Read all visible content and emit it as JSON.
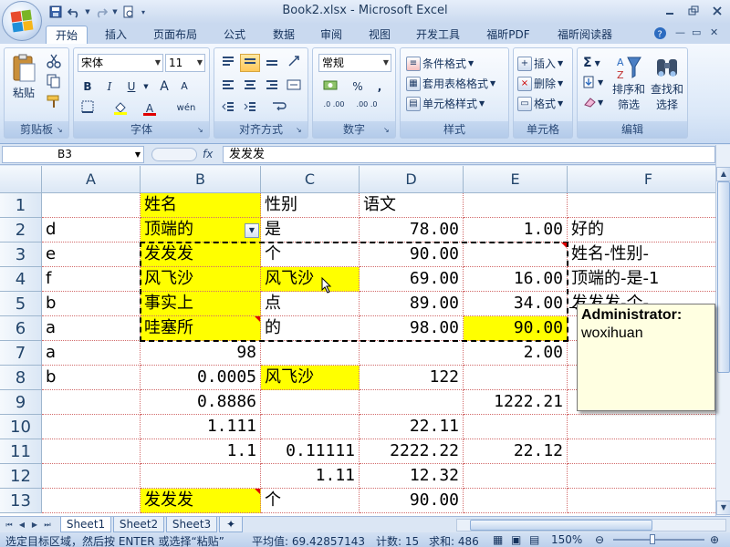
{
  "window": {
    "title": "Book2.xlsx - Microsoft Excel",
    "controls": [
      "minimize-icon",
      "restore-icon",
      "close-icon"
    ]
  },
  "quick_access": [
    "save-icon",
    "undo-icon",
    "redo-icon",
    "print-preview-icon"
  ],
  "tabs": [
    {
      "label": "开始",
      "active": true
    },
    {
      "label": "插入"
    },
    {
      "label": "页面布局"
    },
    {
      "label": "公式"
    },
    {
      "label": "数据"
    },
    {
      "label": "审阅"
    },
    {
      "label": "视图"
    },
    {
      "label": "开发工具"
    },
    {
      "label": "福昕PDF"
    },
    {
      "label": "福昕阅读器"
    }
  ],
  "ribbon": {
    "clipboard": {
      "label": "剪贴板",
      "paste": "粘贴"
    },
    "font": {
      "label": "字体",
      "name": "宋体",
      "size": "11",
      "bold": "B",
      "italic": "I",
      "underline": "U",
      "grow": "A",
      "shrink": "A",
      "font_color": "A",
      "phonetic": "wén"
    },
    "alignment": {
      "label": "对齐方式"
    },
    "number": {
      "label": "数字",
      "format": "常规",
      "percent": "%",
      "comma": ",",
      "inc_decimal": ".0 .00",
      "dec_decimal": ".00 .0"
    },
    "styles": {
      "label": "样式",
      "conditional": "条件格式",
      "table": "套用表格格式",
      "cell": "单元格样式"
    },
    "cells": {
      "label": "单元格",
      "insert": "插入",
      "delete": "删除",
      "format": "格式"
    },
    "editing": {
      "label": "编辑",
      "sum": "Σ",
      "sort_line1": "排序和",
      "sort_line2": "筛选",
      "find_line1": "查找和",
      "find_line2": "选择"
    }
  },
  "formula_bar": {
    "name_box": "B3",
    "fx": "fx",
    "content": "发发发"
  },
  "columns": [
    "A",
    "B",
    "C",
    "D",
    "E",
    "F"
  ],
  "rows": [
    {
      "num": "1",
      "cells": [
        "",
        "姓名",
        "性别",
        "语文",
        "",
        ""
      ]
    },
    {
      "num": "2",
      "cells": [
        "d",
        "顶端的",
        "是",
        "78.00",
        "1.00",
        "好的"
      ]
    },
    {
      "num": "3",
      "cells": [
        "e",
        "发发发",
        "个",
        "90.00",
        "",
        "姓名-性别-"
      ]
    },
    {
      "num": "4",
      "cells": [
        "f",
        "风飞沙",
        "风飞沙",
        "69.00",
        "16.00",
        "顶端的-是-1"
      ]
    },
    {
      "num": "5",
      "cells": [
        "b",
        "事实上",
        "点",
        "89.00",
        "34.00",
        "发发发-个-"
      ]
    },
    {
      "num": "6",
      "cells": [
        "a",
        "哇塞所",
        "的",
        "98.00",
        "90.00",
        ""
      ]
    },
    {
      "num": "7",
      "cells": [
        "a",
        "98",
        "",
        "",
        "2.00",
        ""
      ]
    },
    {
      "num": "8",
      "cells": [
        "b",
        "0.0005",
        "风飞沙",
        "122",
        "",
        ""
      ]
    },
    {
      "num": "9",
      "cells": [
        "",
        "0.8886",
        "",
        "",
        "1222.21",
        ""
      ]
    },
    {
      "num": "10",
      "cells": [
        "",
        "1.111",
        "",
        "22.11",
        "",
        ""
      ]
    },
    {
      "num": "11",
      "cells": [
        "",
        "1.1",
        "0.11111",
        "2222.22",
        "22.12",
        ""
      ]
    },
    {
      "num": "12",
      "cells": [
        "",
        "",
        "1.11",
        "12.32",
        "",
        ""
      ]
    },
    {
      "num": "13",
      "cells": [
        "",
        "发发发",
        "个",
        "90.00",
        "",
        ""
      ]
    }
  ],
  "comment": {
    "author": "Administrator:",
    "text": "woxihuan"
  },
  "sheets": [
    "Sheet1",
    "Sheet2",
    "Sheet3"
  ],
  "status": {
    "message": "选定目标区域，然后按 ENTER 或选择“粘贴”",
    "average": "平均值: 69.42857143",
    "count": "计数: 15",
    "sum": "求和: 486",
    "zoom": "150%"
  },
  "colors": {
    "highlight": "#ffff00",
    "grid_line": "#d26b6b",
    "ribbon_bg": "#dbe8f8"
  }
}
